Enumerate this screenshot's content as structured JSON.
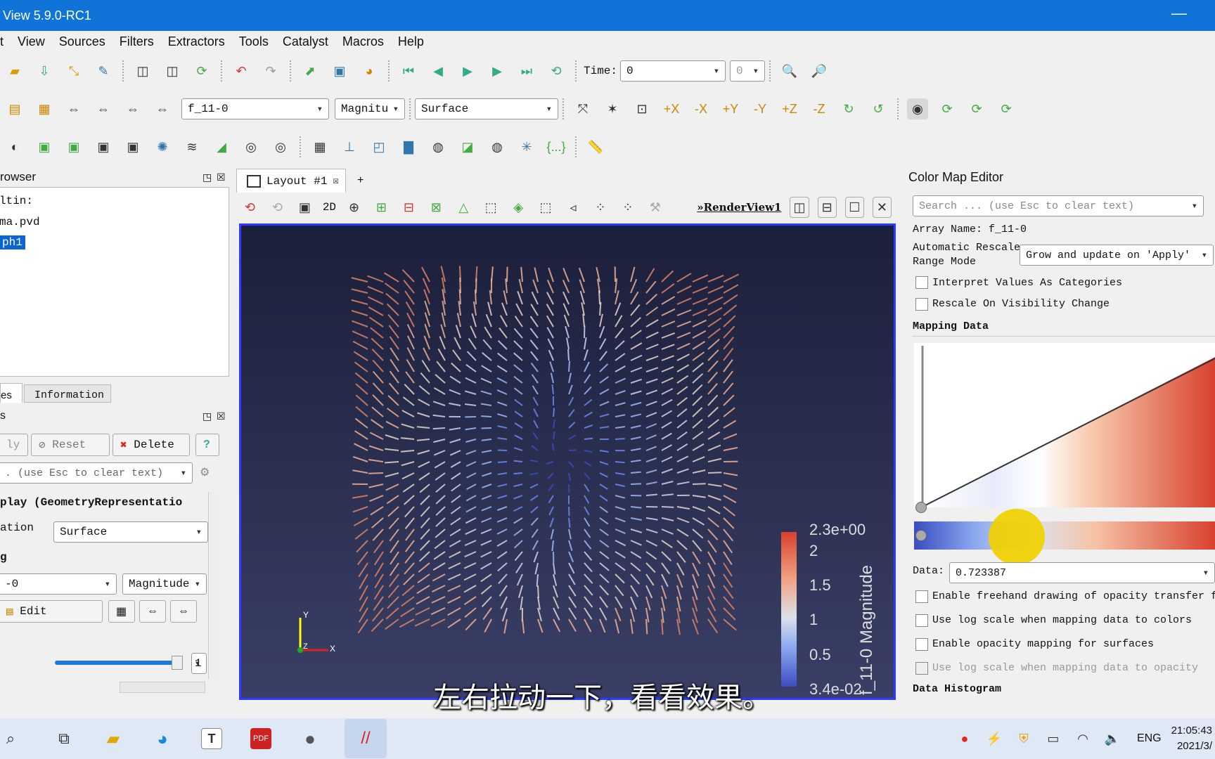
{
  "window": {
    "title": "View 5.9.0-RC1"
  },
  "menu": [
    "t",
    "View",
    "Sources",
    "Filters",
    "Extractors",
    "Tools",
    "Catalyst",
    "Macros",
    "Help"
  ],
  "toolbar": {
    "time_label": "Time:",
    "time_value": "0",
    "time_index": "0",
    "array_combo": "f_11-0",
    "component_combo": "Magnitu",
    "representation_combo": "Surface"
  },
  "pipeline": {
    "title": "rowser",
    "items": [
      "ltin:",
      "ma.pvd",
      "ph1"
    ]
  },
  "tabs": {
    "properties": "es",
    "information": "Information"
  },
  "properties": {
    "title": "s",
    "apply": "ly",
    "reset": "Reset",
    "delete": "Delete",
    "help": "?",
    "search_placeholder": ". (use Esc to clear text)",
    "section": "play (GeometryRepresentatio",
    "rep_label": "ation",
    "rep_value": "Surface",
    "coloring_label": "g",
    "color_array": "-0",
    "color_component": "Magnitude",
    "edit": "Edit",
    "slider_value": "1"
  },
  "layout": {
    "tab": "Layout #1",
    "add_tab": "+",
    "view_name": "RenderView1",
    "mode_2d": "2D"
  },
  "legend": {
    "title": "f_11-0 Magnitude",
    "ticks": [
      "2.3e+00",
      "2",
      "1.5",
      "1",
      "0.5",
      "3.4e-02"
    ]
  },
  "colormap": {
    "title": "Color Map Editor",
    "search_placeholder": "Search ... (use Esc to clear text)",
    "array_name": "Array Name: f_11-0",
    "rescale_label_1": "Automatic Rescale",
    "rescale_label_2": "Range Mode",
    "rescale_value": "Grow and update on 'Apply'",
    "opt_categories": "Interpret Values As Categories",
    "opt_visibility": "Rescale On Visibility Change",
    "mapping_title": "Mapping Data",
    "data_label": "Data:",
    "data_value": "0.723387",
    "opt_freehand": "Enable freehand drawing of opacity transfer func",
    "opt_logcolor": "Use log scale when mapping data to colors",
    "opt_opacity": "Enable opacity mapping for surfaces",
    "opt_logopacity": "Use log scale when mapping data to opacity",
    "histogram_title": "Data Histogram"
  },
  "subtitle": "左右拉动一下，看看效果。",
  "taskbar": {
    "lang": "ENG",
    "time": "21:05:43",
    "date": "2021/3/"
  },
  "colors": {
    "accent": "#0f73d8",
    "selection": "#0a64d8",
    "render_border": "#2b3bff"
  }
}
